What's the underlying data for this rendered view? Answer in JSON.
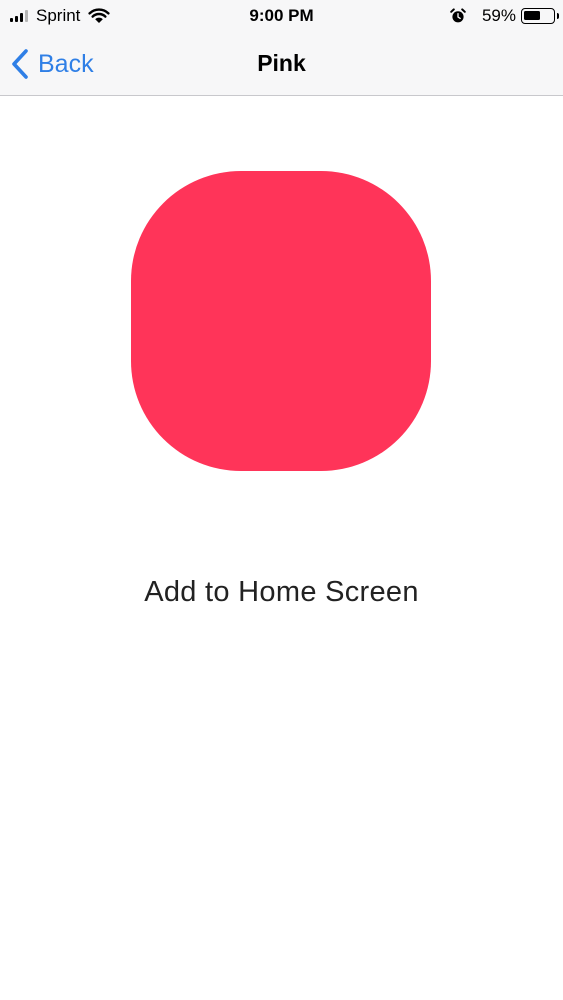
{
  "status_bar": {
    "carrier": "Sprint",
    "time": "9:00 PM",
    "battery_percent": "59%",
    "battery_level": 0.59,
    "signal_bars_active": 3,
    "signal_bars_total": 4,
    "icons": [
      "signal-icon",
      "wifi-icon",
      "alarm-icon",
      "battery-icon"
    ]
  },
  "nav_bar": {
    "back_label": "Back",
    "title": "Pink",
    "back_icon": "chevron-left-icon",
    "accent_color": "#2f7fe6"
  },
  "content": {
    "icon_color": "#ff3459",
    "action_label": "Add to Home Screen"
  }
}
